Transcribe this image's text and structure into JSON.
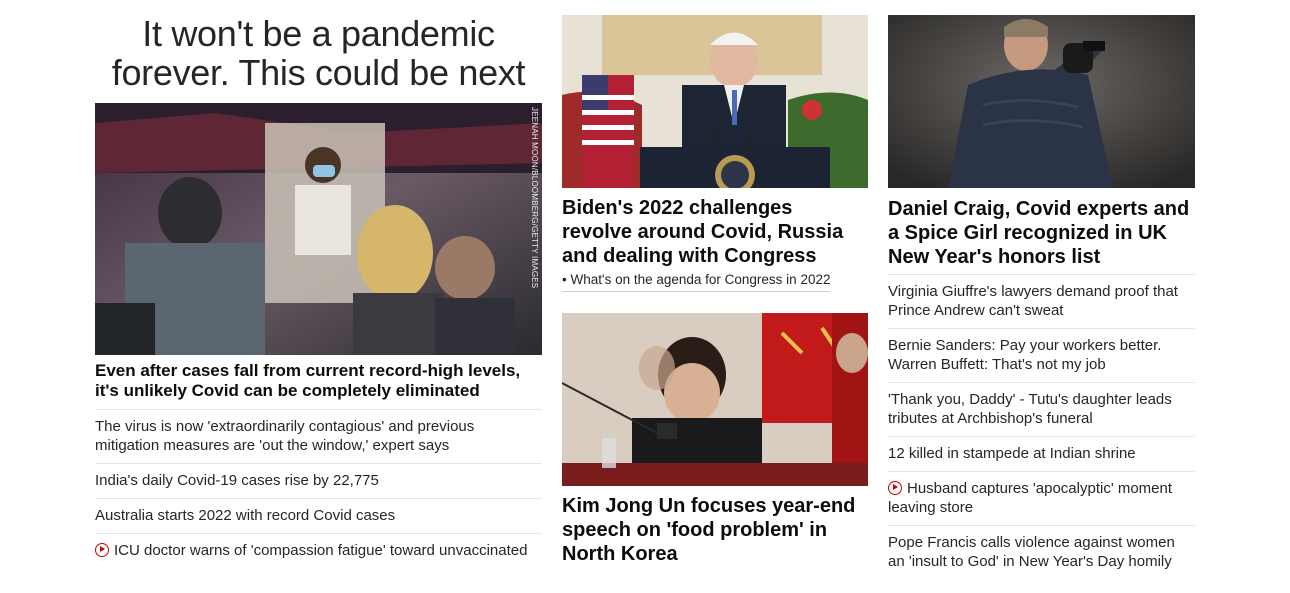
{
  "column1": {
    "title_line1": "It won't be a pandemic",
    "title_line2": "forever. This could be next",
    "image_credit": "JEENAH MOON/BLOOMBERG/GETTY IMAGES",
    "lead_headline": "Even after cases fall from current record-high levels, it's unlikely Covid can be completely eliminated",
    "related": [
      {
        "text": "The virus is now 'extraordinarily contagious' and previous mitigation measures are 'out the window,' expert says",
        "video": false
      },
      {
        "text": "India's daily Covid-19 cases rise by 22,775",
        "video": false
      },
      {
        "text": "Australia starts 2022 with record Covid cases",
        "video": false
      },
      {
        "text": "ICU doctor warns of 'compassion fatigue' toward unvaccinated",
        "video": true
      }
    ]
  },
  "column2": {
    "story1_headline": "Biden's 2022 challenges revolve around Covid, Russia and dealing with Congress",
    "story1_link": "• What's on the agenda for Congress in 2022",
    "story2_headline": "Kim Jong Un focuses year-end speech on 'food problem' in North Korea"
  },
  "column3": {
    "headline": "Daniel Craig, Covid experts and a Spice Girl recognized in UK New Year's honors list",
    "related": [
      {
        "text": "Virginia Giuffre's lawyers demand proof that Prince Andrew can't sweat",
        "video": false
      },
      {
        "text": "Bernie Sanders: Pay your workers better. Warren Buffett: That's not my job",
        "video": false
      },
      {
        "text": "'Thank you, Daddy' - Tutu's daughter leads tributes at Archbishop's funeral",
        "video": false
      },
      {
        "text": "12 killed in stampede at Indian shrine",
        "video": false
      },
      {
        "text": "Husband captures 'apocalyptic' moment leaving store",
        "video": true
      },
      {
        "text": "Pope Francis calls violence against women an 'insult to God' in New Year's Day homily",
        "video": false
      }
    ]
  },
  "colors": {
    "accent_red": "#cc0000",
    "text": "#0c0c0c",
    "divider": "#e6e6e6"
  }
}
